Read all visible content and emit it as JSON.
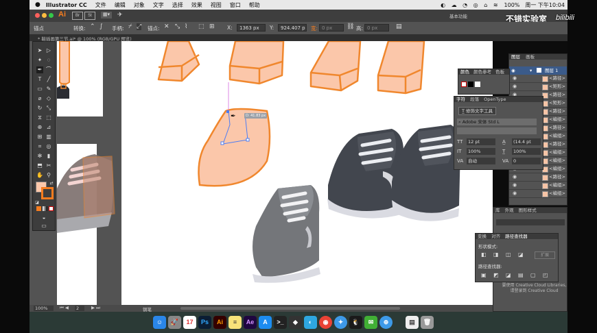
{
  "menubar": {
    "apple": "",
    "app_name": "Illustrator CC",
    "items": [
      "文件",
      "编辑",
      "对象",
      "文字",
      "选择",
      "效果",
      "视图",
      "窗口",
      "帮助"
    ],
    "battery": "100%",
    "clock": "周一 下午10:04"
  },
  "appbar": {
    "logo": "Ai",
    "workspace": "基本功能"
  },
  "watermark": {
    "channel": "不错实验室",
    "site": "bilibili"
  },
  "control": {
    "anchor_label": "锚点",
    "convert_label": "转换:",
    "handle_label": "手柄:",
    "anchor2_label": "锚点:",
    "x_label": "X:",
    "x_value": "1363 px",
    "y_label": "Y:",
    "y_value": "924.407 p",
    "w_label": "宽:",
    "w_value": "0 px",
    "h_label": "高:",
    "h_value": "0 px"
  },
  "doc_tab": {
    "title": "* 鞋插画第三节.ai* @ 100% (RGB/GPU 预览)"
  },
  "canvas": {
    "smart_guide": "D: 41.83 px"
  },
  "status": {
    "zoom": "100%",
    "page": "2",
    "tool": "钢笔"
  },
  "panels": {
    "layers": {
      "tabs": [
        "图层",
        "画板"
      ],
      "top_layer": "图层 1",
      "rows": [
        "<路径>",
        "<矩形>",
        "<路径>",
        "<矩形>",
        "<路径>",
        "<编组>",
        "<路径>",
        "<编组>",
        "<路径>",
        "<编组>",
        "<编组>",
        "<编组>",
        "<路径>",
        "<编组>",
        "<编组>"
      ]
    },
    "color": {
      "tabs": [
        "颜色",
        "颜色参考",
        "色板"
      ]
    },
    "character": {
      "tabs": [
        "字符",
        "段落",
        "OpenType"
      ],
      "touch_type": "修饰文字工具",
      "font_family": "Adobe 宋体 Std L",
      "font_style": "",
      "size": "12 pt",
      "leading": "(14.4 pt",
      "h_scale": "100%",
      "v_scale": "100%",
      "kerning": "自动",
      "tracking": "0"
    },
    "transform": {
      "tabs": [
        "库",
        "外观",
        "图形样式"
      ]
    },
    "pathfinder": {
      "tabs": [
        "变换",
        "对齐",
        "路径查找器"
      ],
      "shape_modes": "形状模式:",
      "expand": "扩展",
      "pathfinders": "路径查找器:"
    },
    "libraries": {
      "line1": "要使用 Creative Cloud Libraries,",
      "line2": "请登录到 Creative Cloud"
    }
  },
  "dock_apps": [
    "Finder",
    "Launchpad",
    "日历",
    "Ps",
    "Ai",
    "备忘录",
    "Ae",
    "App Store",
    "终端",
    "Unity",
    "QQ",
    "Chrome",
    "Safari",
    "QQ",
    "微信",
    "Safari",
    "预览",
    "废纸篓"
  ],
  "colors": {
    "skin": "#fbc7aa",
    "outline": "#f0872d",
    "shoe_dark": "#42464e",
    "shoe_grey": "#74767a",
    "accent": "#f57c1f"
  }
}
